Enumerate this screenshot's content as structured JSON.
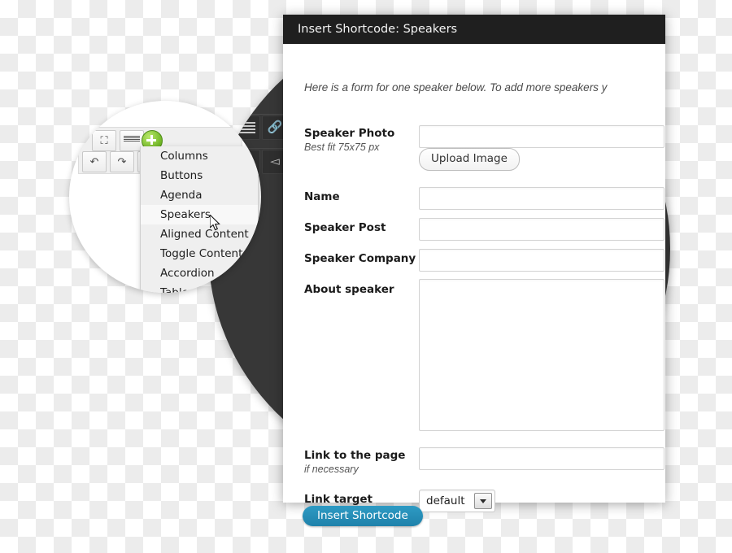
{
  "modal": {
    "title": "Insert Shortcode: Speakers",
    "intro": "Here is a form for one speaker below. To add more speakers y",
    "fields": {
      "photo": {
        "label": "Speaker Photo",
        "sub": "Best fit 75x75 px",
        "value": "",
        "upload_label": "Upload Image"
      },
      "name": {
        "label": "Name",
        "value": ""
      },
      "post": {
        "label": "Speaker Post",
        "value": ""
      },
      "company": {
        "label": "Speaker Company",
        "value": ""
      },
      "about": {
        "label": "About speaker",
        "value": ""
      },
      "link": {
        "label": "Link to the page",
        "sub": "if necessary",
        "value": ""
      },
      "target": {
        "label": "Link target",
        "selected": "default"
      }
    },
    "submit_label": "Insert Shortcode"
  },
  "editor": {
    "toolbar": [
      {
        "name": "fullscreen-icon",
        "glyph": "⛶"
      },
      {
        "name": "keyboard-icon",
        "glyph": ""
      },
      {
        "name": "add-shortcode-icon",
        "glyph": "+"
      },
      {
        "name": "undo-icon",
        "glyph": "↶"
      },
      {
        "name": "redo-icon",
        "glyph": "↷"
      },
      {
        "name": "help-icon",
        "glyph": "?"
      }
    ],
    "menu_items": [
      {
        "label": "Columns",
        "selected": false
      },
      {
        "label": "Buttons",
        "selected": false
      },
      {
        "label": "Agenda",
        "selected": false
      },
      {
        "label": "Speakers",
        "selected": true
      },
      {
        "label": "Aligned Content",
        "selected": false
      },
      {
        "label": "Toggle Content",
        "selected": false
      },
      {
        "label": "Accordion",
        "selected": false
      },
      {
        "label": "Table",
        "selected": false
      }
    ]
  },
  "colors": {
    "title_bar": "#1f1f1f",
    "dark_circle": "#373737",
    "accent_button": "#2e9bc4",
    "plus_green": "#6fb524"
  }
}
